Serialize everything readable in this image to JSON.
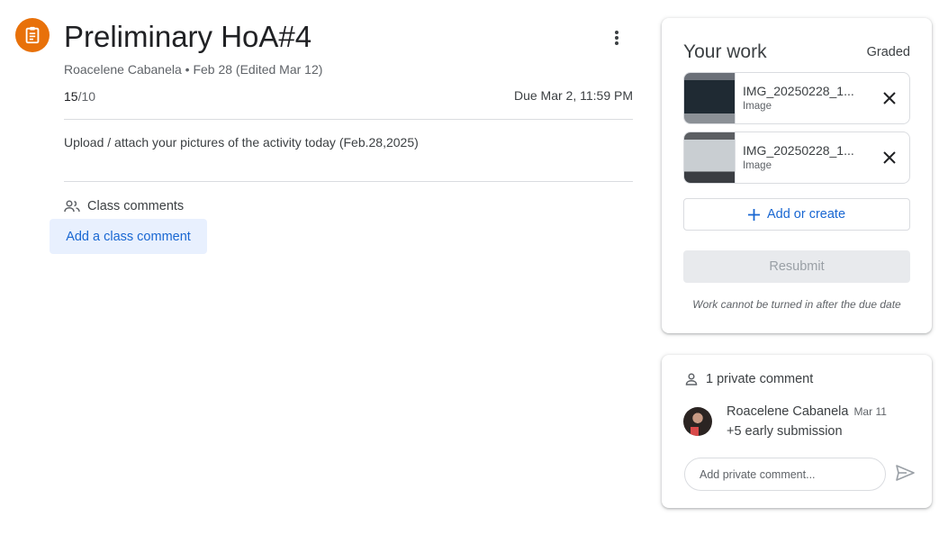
{
  "assignment": {
    "icon": "assignment-icon",
    "icon_color": "#e8710a",
    "title": "Preliminary HoA#4",
    "author": "Roacelene Cabanela",
    "separator": "•",
    "posted": "Feb 28 (Edited Mar 12)",
    "score": "15",
    "total": "/10",
    "due": "Due Mar 2, 11:59 PM",
    "instructions": "Upload / attach your pictures of the activity today (Feb.28,2025)"
  },
  "class_comments": {
    "header": "Class comments",
    "add_label": "Add a class comment"
  },
  "your_work": {
    "title": "Your work",
    "status": "Graded",
    "attachments": [
      {
        "name": "IMG_20250228_1...",
        "type": "Image"
      },
      {
        "name": "IMG_20250228_1...",
        "type": "Image"
      }
    ],
    "add_label": "Add or create",
    "resubmit_label": "Resubmit",
    "note": "Work cannot be turned in after the due date"
  },
  "private_comments": {
    "header": "1 private comment",
    "comment": {
      "author": "Roacelene Cabanela",
      "date": "Mar 11",
      "text": "+5 early submission"
    },
    "input_placeholder": "Add private comment..."
  },
  "colors": {
    "accent_blue": "#1967d2",
    "chip_bg": "#e8f0fe",
    "orange": "#e8710a"
  }
}
